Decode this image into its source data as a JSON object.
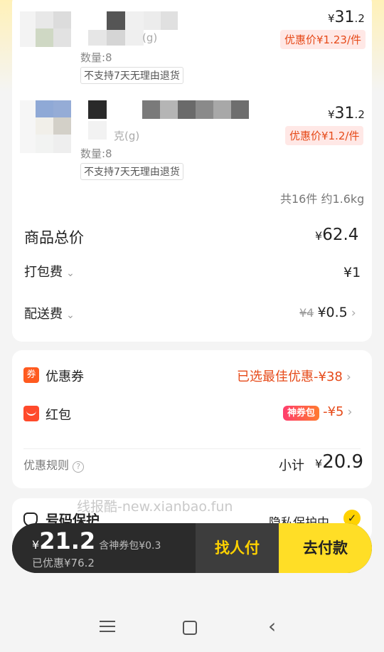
{
  "items": [
    {
      "price_yen": "¥",
      "price_int": "31",
      "price_dec": ".2",
      "promo": "优惠价¥1.23/件",
      "spec": "(g)",
      "qty": "数量:8",
      "tag": "不支持7天无理由退货"
    },
    {
      "price_yen": "¥",
      "price_int": "31",
      "price_dec": ".2",
      "promo": "优惠价¥1.2/件",
      "spec": "克(g)",
      "qty": "数量:8",
      "tag": "不支持7天无理由退货"
    }
  ],
  "summary": {
    "count_weight": "共16件 约1.6kg",
    "goods_total_label": "商品总价",
    "goods_total_yen": "¥",
    "goods_total_value": "62.4",
    "packing_label": "打包费",
    "packing_value": "¥1",
    "delivery_label": "配送费",
    "delivery_original": "¥4",
    "delivery_value": "¥0.5"
  },
  "discounts": {
    "coupon_icon": "券",
    "coupon_label": "优惠券",
    "coupon_value": "已选最佳优惠-¥38",
    "redpack_label": "红包",
    "redpack_badge": "神券包",
    "redpack_value": "-¥5",
    "rules_label": "优惠规则",
    "subtotal_label": "小计",
    "subtotal_yen": "¥",
    "subtotal_value": "20.9"
  },
  "privacy": {
    "label": "号码保护",
    "value": "隐私保护中"
  },
  "watermark": "线报酷-new.xianbao.fun",
  "checkout": {
    "yen": "¥",
    "total": "21.2",
    "includes": "含神券包¥0.3",
    "saved": "已优惠¥76.2",
    "find_pay": "找人付",
    "pay": "去付款"
  },
  "colors": {
    "accent_yellow": "#ffde26",
    "discount_red": "#e64a19",
    "bar_dark": "#2b2b2b"
  },
  "icons": {
    "nav_menu": "menu-icon",
    "nav_home": "home-icon",
    "nav_back": "back-icon"
  }
}
